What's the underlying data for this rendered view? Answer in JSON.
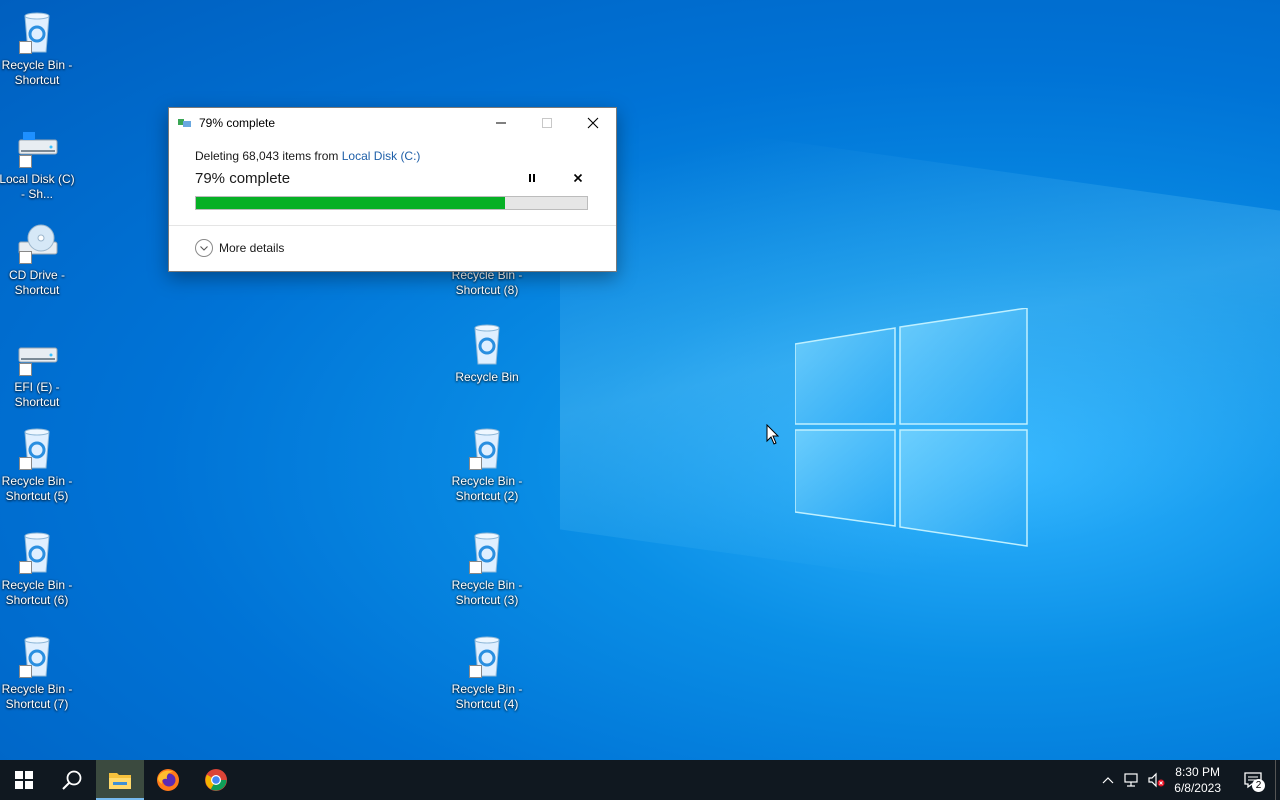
{
  "dialog": {
    "title": "79% complete",
    "message_prefix": "Deleting 68,043 items from ",
    "message_link": "Local Disk (C:)",
    "percent_text": "79% complete",
    "progress_percent": 79,
    "more_details": "More details",
    "progress_color": "#06b025",
    "link_color": "#1e5fa8"
  },
  "desktop": {
    "left_column": [
      {
        "label": "Recycle Bin - Shortcut",
        "icon": "recycle-bin-icon"
      },
      {
        "label": "Local Disk (C) - Sh...",
        "icon": "local-disk-icon"
      },
      {
        "label": "CD Drive - Shortcut",
        "icon": "cd-drive-icon"
      },
      {
        "label": "EFI (E) - Shortcut",
        "icon": "drive-icon"
      },
      {
        "label": "Recycle Bin - Shortcut (5)",
        "icon": "recycle-bin-icon"
      },
      {
        "label": "Recycle Bin - Shortcut (6)",
        "icon": "recycle-bin-icon"
      },
      {
        "label": "Recycle Bin - Shortcut (7)",
        "icon": "recycle-bin-icon"
      }
    ],
    "middle_column": [
      {
        "label": "Recycle Bin - Shortcut (8)",
        "icon": "recycle-bin-icon"
      },
      {
        "label": "Recycle Bin",
        "icon": "recycle-bin-icon"
      },
      {
        "label": "Recycle Bin - Shortcut (2)",
        "icon": "recycle-bin-icon"
      },
      {
        "label": "Recycle Bin - Shortcut (3)",
        "icon": "recycle-bin-icon"
      },
      {
        "label": "Recycle Bin - Shortcut (4)",
        "icon": "recycle-bin-icon"
      }
    ]
  },
  "taskbar": {
    "time": "8:30 PM",
    "date": "6/8/2023",
    "notification_count": "2"
  }
}
